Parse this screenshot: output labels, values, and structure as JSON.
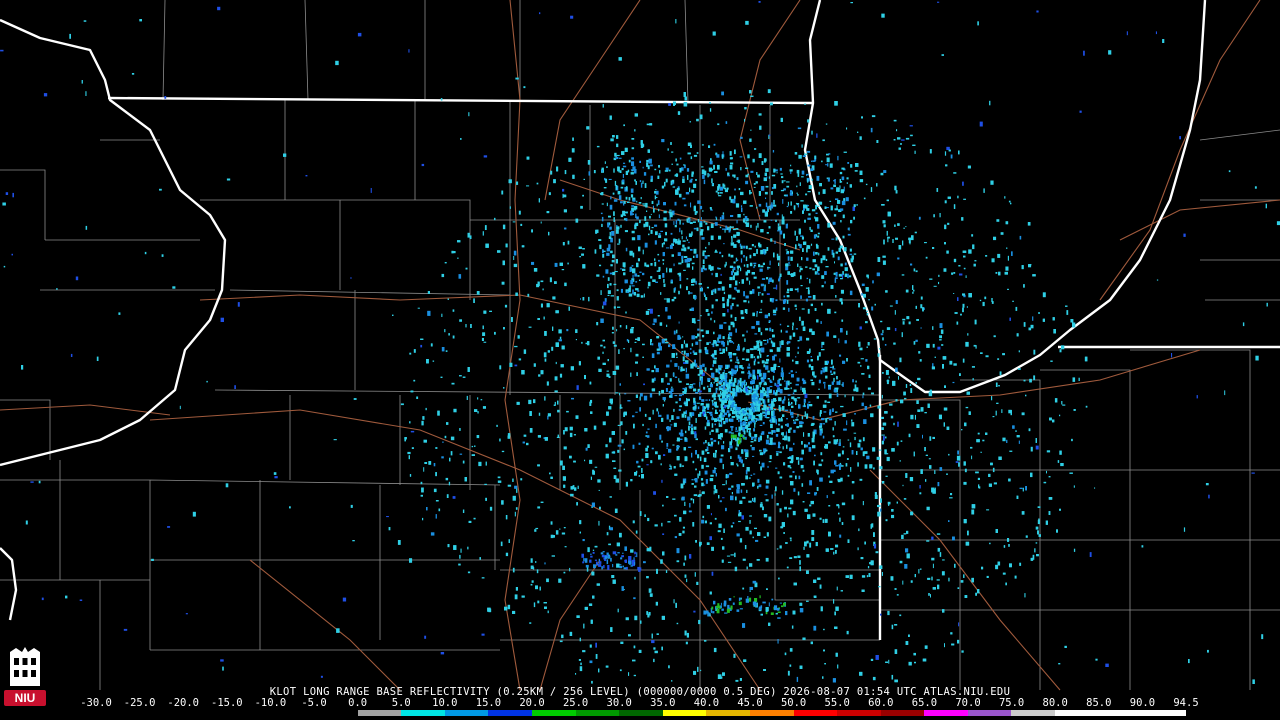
{
  "product_caption": "KLOT LONG RANGE BASE REFLECTIVITY (0.25KM / 256 LEVEL) (000000/0000 0.5 DEG) 2026-08-07 01:54 UTC  ATLAS.NIU.EDU",
  "logo_text": "NIU",
  "radar_site": "KLOT",
  "scale": {
    "labels": [
      "-30.0",
      "-25.0",
      "-20.0",
      "-15.0",
      "-10.0",
      "-5.0",
      "0.0",
      "5.0",
      "10.0",
      "15.0",
      "20.0",
      "25.0",
      "30.0",
      "35.0",
      "40.0",
      "45.0",
      "50.0",
      "55.0",
      "60.0",
      "65.0",
      "70.0",
      "75.0",
      "80.0",
      "85.0",
      "90.0",
      "94.5"
    ],
    "colors": [
      "#000000",
      "#000000",
      "#000000",
      "#000000",
      "#000000",
      "#000000",
      "#a3a3a3",
      "#00e6e6",
      "#0099e6",
      "#0033e6",
      "#00cc00",
      "#009900",
      "#006600",
      "#ffff00",
      "#e6b800",
      "#ff8000",
      "#ff0000",
      "#cc0000",
      "#990000",
      "#ff00ff",
      "#9955cc",
      "#cccccc",
      "#ffffff",
      "#ffffff",
      "#ffffff"
    ]
  },
  "colors": {
    "background": "#000000",
    "state_border": "#ffffff",
    "county_border": "#8c8c8c",
    "highway": "#a05a3c",
    "echo_light": "#2fd0e6",
    "echo_mid": "#1a8fe0",
    "echo_strong": "#1f4fe6",
    "echo_green": "#22bb22"
  }
}
